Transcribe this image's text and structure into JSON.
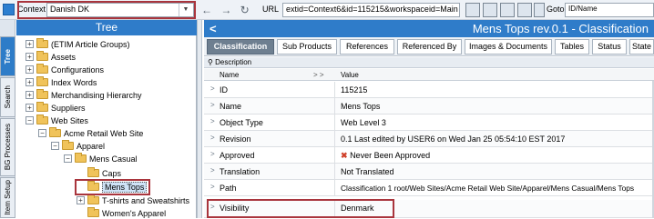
{
  "context": {
    "label": "Context",
    "value": "Danish DK"
  },
  "toolbar": {
    "nav_icons": "← → ↻",
    "url_label": "URL",
    "url_value": "extid=Context6&id=115215&workspaceid=Main",
    "goto_label": "Goto",
    "goto_value": "ID/Name"
  },
  "left_tabs": [
    "Tree",
    "Search",
    "BG Processes",
    "Item Setup"
  ],
  "tree": {
    "title": "Tree",
    "nodes": [
      {
        "label": "(ETIM Article Groups)",
        "exp": "+"
      },
      {
        "label": "Assets",
        "exp": "+"
      },
      {
        "label": "Configurations",
        "exp": "+"
      },
      {
        "label": "Index Words",
        "exp": "+"
      },
      {
        "label": "Merchandising Hierarchy",
        "exp": "+"
      },
      {
        "label": "Suppliers",
        "exp": "+"
      },
      {
        "label": "Web Sites",
        "exp": "−"
      },
      {
        "label": "Acme Retail Web Site",
        "exp": "−"
      },
      {
        "label": "Apparel",
        "exp": "−"
      },
      {
        "label": "Mens Casual",
        "exp": "−"
      },
      {
        "label": "Caps",
        "exp": ""
      },
      {
        "label": "Mens Tops",
        "exp": ""
      },
      {
        "label": "T-shirts and Sweatshirts",
        "exp": "+"
      },
      {
        "label": "Women's Apparel",
        "exp": ""
      }
    ]
  },
  "details": {
    "back_icon": "<",
    "title": "Mens Tops rev.0.1 - Classification",
    "tabs": [
      "Classification",
      "Sub Products",
      "References",
      "Referenced By",
      "Images & Documents",
      "Tables",
      "Status",
      "State"
    ],
    "description_label": "Description",
    "col_name": "Name",
    "col_value": "Value",
    "col_arrows": ">  >",
    "rows": [
      {
        "name": "ID",
        "value": "115215"
      },
      {
        "name": "Name",
        "value": "Mens Tops"
      },
      {
        "name": "Object Type",
        "value": "Web Level 3"
      },
      {
        "name": "Revision",
        "value": "0.1 Last edited by USER6 on Wed Jan 25 05:54:10 EST 2017"
      },
      {
        "name": "Approved",
        "value": "Never Been Approved",
        "icon": "✖"
      },
      {
        "name": "Translation",
        "value": "Not Translated"
      },
      {
        "name": "Path",
        "value": "Classification 1 root/Web Sites/Acme Retail Web Site/Apparel/Mens Casual/Mens Tops"
      },
      {
        "name": "Visibility",
        "value": "Denmark"
      }
    ]
  }
}
